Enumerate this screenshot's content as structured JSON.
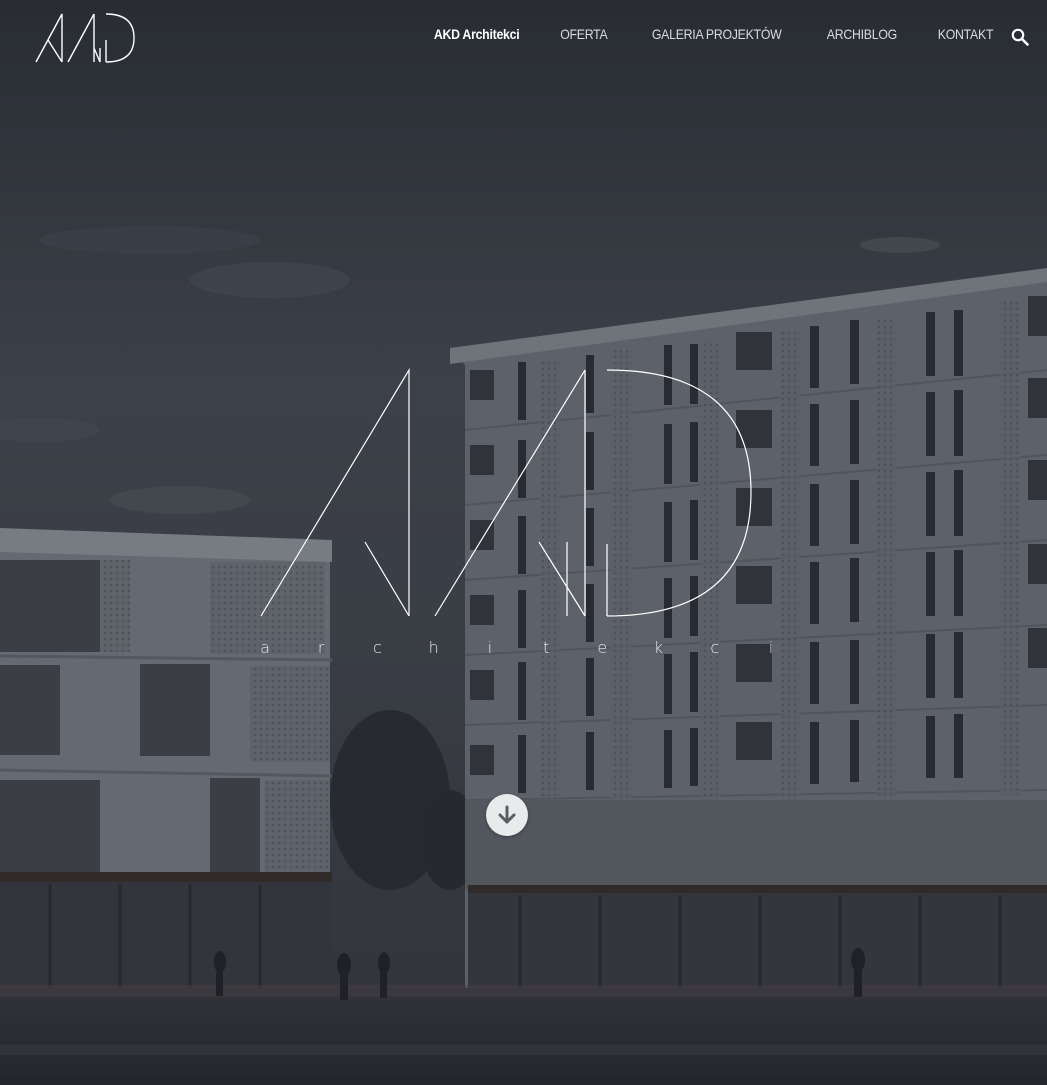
{
  "brand": {
    "logo_name": "akd-logo"
  },
  "nav": {
    "items": [
      {
        "label": "AKD Architekci",
        "active": true
      },
      {
        "label": "OFERTA",
        "active": false
      },
      {
        "label": "GALERIA PROJEKTÓW",
        "active": false
      },
      {
        "label": "ARCHIBLOG",
        "active": false
      },
      {
        "label": "KONTAKT",
        "active": false
      }
    ],
    "search_icon": "search-icon"
  },
  "hero": {
    "tagline_letters": [
      "a",
      "r",
      "c",
      "h",
      "i",
      "t",
      "e",
      "k",
      "c",
      "i"
    ],
    "scroll_icon": "arrow-down-icon"
  },
  "colors": {
    "nav_text": "#d9dbe0",
    "nav_active": "#ffffff",
    "logo_stroke": "#ffffff",
    "scroll_button_bg": "#e9eaec",
    "scroll_arrow": "#5a5d63"
  }
}
